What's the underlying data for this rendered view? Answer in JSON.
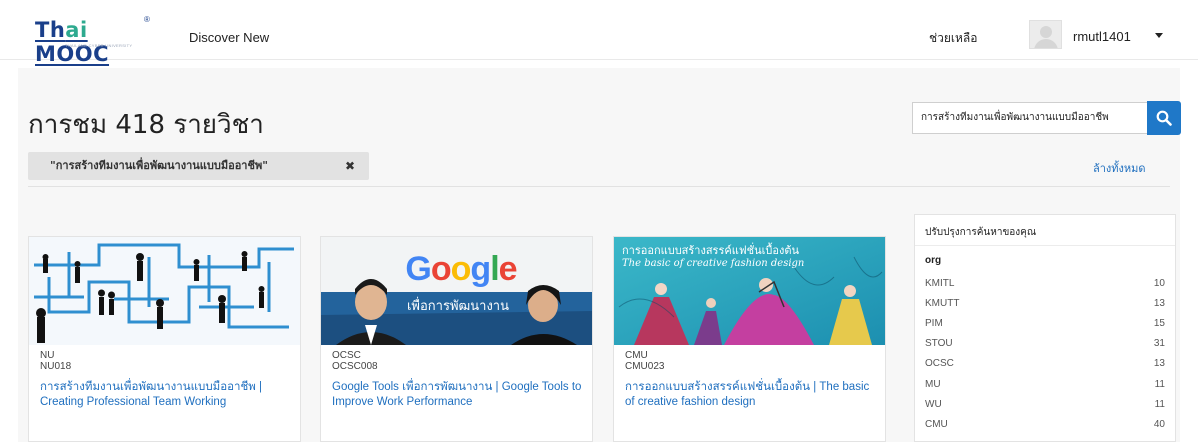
{
  "header": {
    "logo": {
      "text_prefix": "Th",
      "text_accent": "ai",
      "text_suffix": " MOOC",
      "superscript": "®",
      "tagline": "THAILAND CYBER UNIVERSITY"
    },
    "nav": {
      "discover_label": "Discover New"
    },
    "help_label": "ช่วยเหลือ",
    "username": "rmutl1401"
  },
  "results": {
    "title": "การชม 418 รายวิชา"
  },
  "search": {
    "value": "การสร้างทีมงานเพื่อพัฒนางานแบบมืออาชีพ",
    "button_icon": "search-icon"
  },
  "active_filter": {
    "label": "\"การสร้างทีมงานเพื่อพัฒนางานแบบมืออาชีพ\"",
    "remove_icon": "close-icon"
  },
  "clear_all_label": "ล้างทั้งหมด",
  "courses": [
    {
      "org": "NU",
      "code": "NU018",
      "title": "การสร้างทีมงานเพื่อพัฒนางานแบบมืออาชีพ | Creating Professional Team Working",
      "image": "team-network-illustration"
    },
    {
      "org": "OCSC",
      "code": "OCSC008",
      "title": "Google Tools เพื่อการพัฒนางาน | Google Tools to Improve Work Performance",
      "image": "google-banner",
      "image_text_main": "Google",
      "image_text_sub": "เพื่อการพัฒนางาน"
    },
    {
      "org": "CMU",
      "code": "CMU023",
      "title": "การออกแบบสร้างสรรค์แฟชั่นเบื้องต้น | The basic of creative fashion design",
      "image": "fashion-illustration",
      "image_text_th": "การออกแบบสร้างสรรค์แฟชั่นเบื้องต้น",
      "image_text_en": "The basic of creative fashion design"
    }
  ],
  "refine": {
    "title": "ปรับปรุงการค้นหาของคุณ",
    "group_label": "org",
    "items": [
      {
        "label": "KMITL",
        "count": "10"
      },
      {
        "label": "KMUTT",
        "count": "13"
      },
      {
        "label": "PIM",
        "count": "15"
      },
      {
        "label": "STOU",
        "count": "31"
      },
      {
        "label": "OCSC",
        "count": "13"
      },
      {
        "label": "MU",
        "count": "11"
      },
      {
        "label": "WU",
        "count": "11"
      },
      {
        "label": "CMU",
        "count": "40"
      }
    ]
  },
  "colors": {
    "brand_blue": "#1a3f8a",
    "brand_teal": "#2eaa8f",
    "link_blue": "#1f6fbf",
    "search_button": "#1f78c8",
    "chip_bg": "#e2e2e2",
    "panel_bg": "#f7f7f7"
  }
}
